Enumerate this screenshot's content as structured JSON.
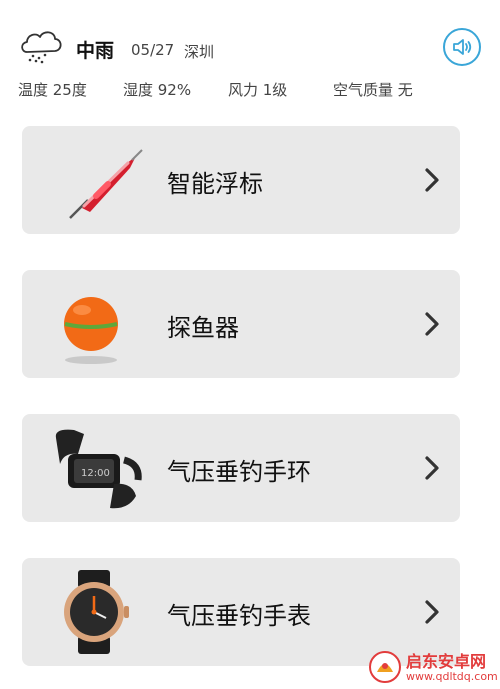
{
  "weather": {
    "icon": "rain-cloud-icon",
    "condition": "中雨",
    "date": "05/27",
    "city": "深圳",
    "stats": {
      "temperature": "温度 25度",
      "humidity": "湿度 92%",
      "wind": "风力 1级",
      "air_quality": "空气质量 无"
    }
  },
  "sound_button": {
    "icon": "speaker-icon",
    "color": "#3aa6d8"
  },
  "devices": [
    {
      "label": "智能浮标",
      "icon": "smart-float-image"
    },
    {
      "label": "探鱼器",
      "icon": "fish-finder-image"
    },
    {
      "label": "气压垂钓手环",
      "icon": "fitness-band-image"
    },
    {
      "label": "气压垂钓手表",
      "icon": "smartwatch-image"
    }
  ],
  "card_background": "#e9e9e9",
  "watermark": {
    "title": "启东安卓网",
    "url": "www.qdltdq.com",
    "color": "#e23c3c"
  }
}
